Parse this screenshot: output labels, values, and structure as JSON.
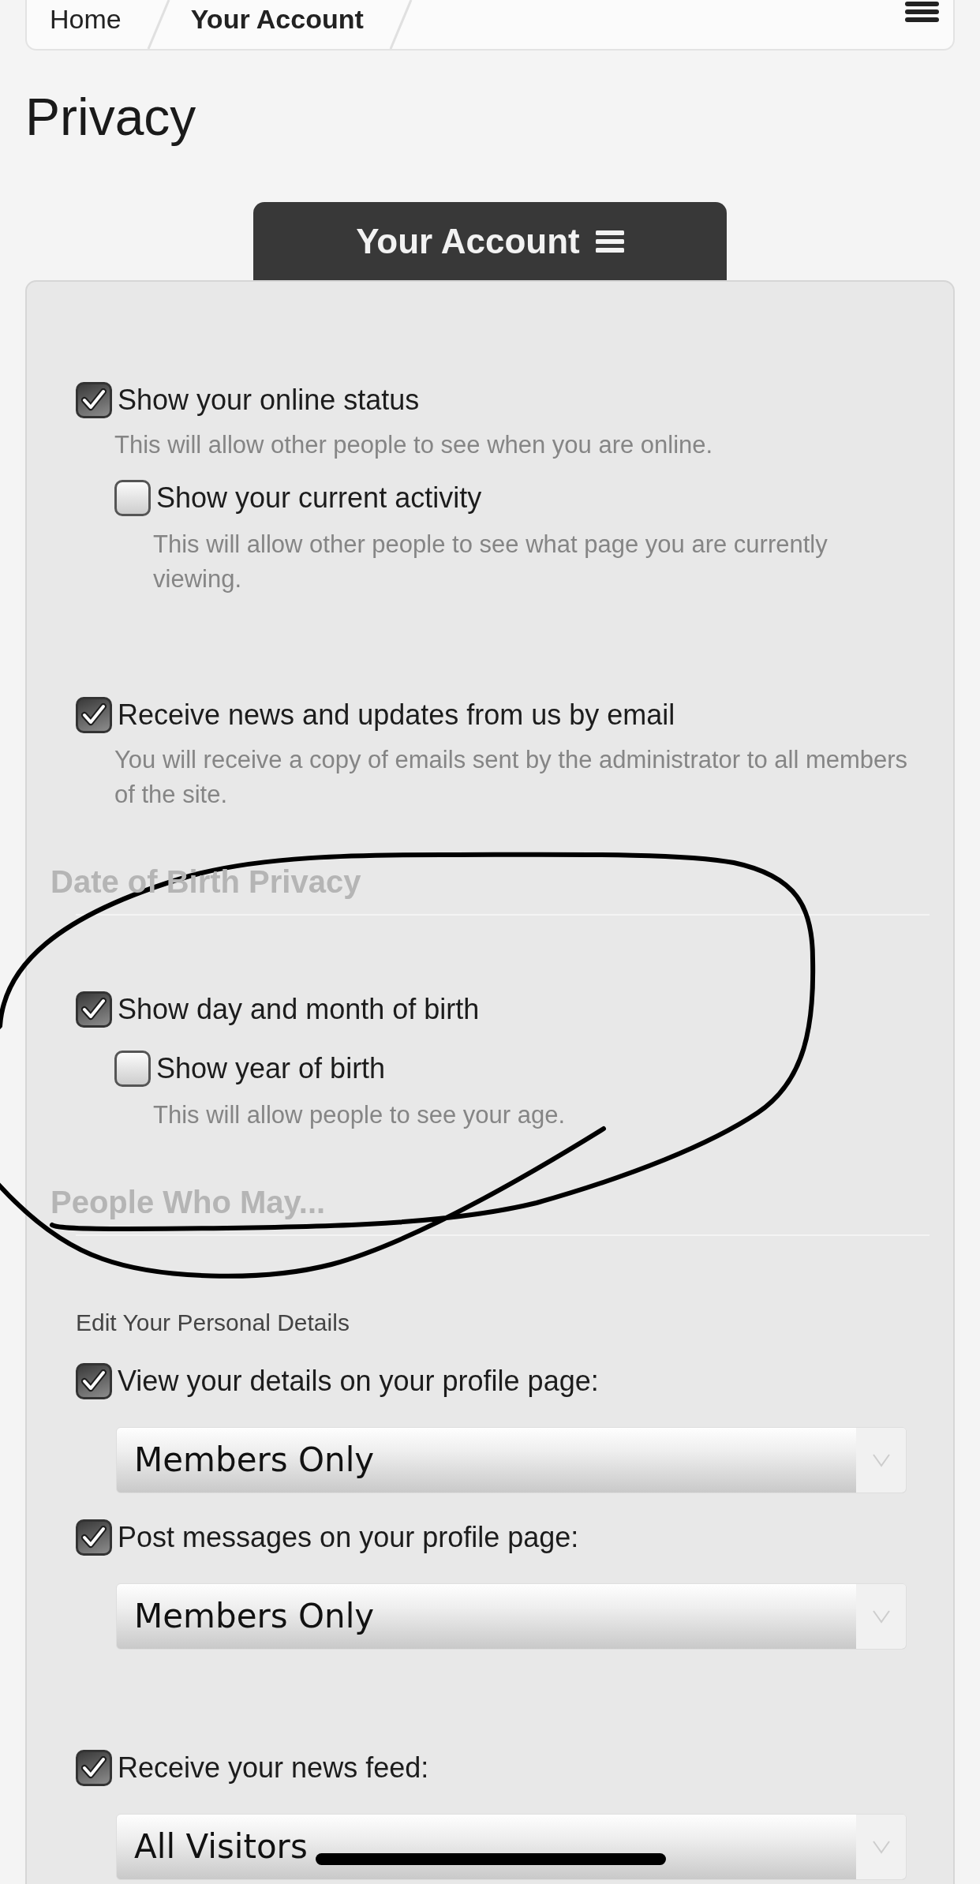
{
  "breadcrumb": {
    "items": [
      {
        "label": "Home",
        "selected": false
      },
      {
        "label": "Your Account",
        "selected": true
      }
    ]
  },
  "page_title": "Privacy",
  "account_tab": {
    "label": "Your Account"
  },
  "sections": [
    {
      "groups": [
        {
          "options": [
            {
              "label": "Show your online status",
              "checked": true,
              "description": "This will allow other people to see when you are online.",
              "children": [
                {
                  "label": "Show your current activity",
                  "checked": false,
                  "description": "This will allow other people to see what page you are currently viewing."
                }
              ]
            }
          ]
        },
        {
          "options": [
            {
              "label": "Receive news and updates from us by email",
              "checked": true,
              "description": "You will receive a copy of emails sent by the administrator to all members of the site."
            }
          ]
        }
      ]
    },
    {
      "heading": "Date of Birth Privacy",
      "groups": [
        {
          "options": [
            {
              "label": "Show day and month of birth",
              "checked": true,
              "children": [
                {
                  "label": "Show year of birth",
                  "checked": false,
                  "description": "This will allow people to see your age."
                }
              ]
            }
          ]
        }
      ]
    },
    {
      "heading": "People Who May...",
      "groups": [
        {
          "caption": "Edit Your Personal Details",
          "options": [
            {
              "label": "View your details on your profile page:",
              "checked": true,
              "select": {
                "value": "Members Only"
              }
            },
            {
              "label": "Post messages on your profile page:",
              "checked": true,
              "select": {
                "value": "Members Only"
              }
            }
          ]
        },
        {
          "options": [
            {
              "label": "Receive your news feed:",
              "checked": true,
              "select": {
                "value": "All Visitors"
              }
            }
          ]
        }
      ]
    }
  ]
}
